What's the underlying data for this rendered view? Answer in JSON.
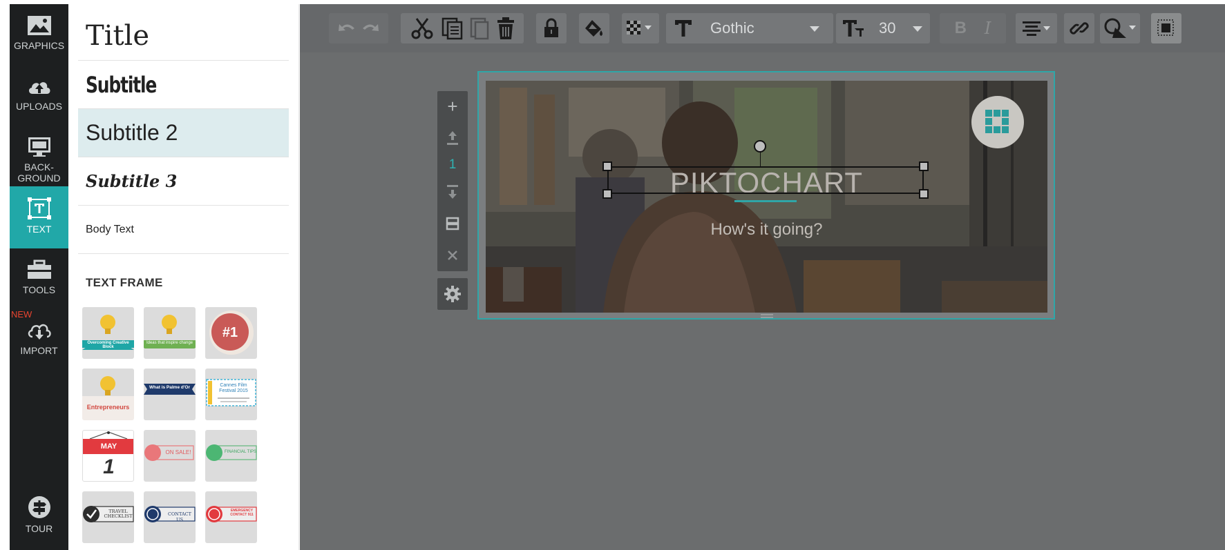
{
  "nav": {
    "items": [
      {
        "label": "GRAPHICS"
      },
      {
        "label": "UPLOADS"
      },
      {
        "label": "BACK-\nGROUND"
      },
      {
        "label": "TEXT"
      },
      {
        "label": "TOOLS"
      },
      {
        "label": "IMPORT",
        "badge": "NEW"
      }
    ],
    "tour": {
      "label": "TOUR"
    }
  },
  "panel": {
    "styles": [
      {
        "label": "Title"
      },
      {
        "label": "Subtitle"
      },
      {
        "label": "Subtitle 2"
      },
      {
        "label": "Subtitle 3"
      },
      {
        "label": "Body Text"
      }
    ],
    "frames_heading": "TEXT FRAME",
    "frames": [
      {
        "text": "Overcoming Creative Block"
      },
      {
        "text": "Ideas that inspire change"
      },
      {
        "text": "#1"
      },
      {
        "text": "Entrepreneurs"
      },
      {
        "text": "What is Palme d'Or"
      },
      {
        "text": "Cannes Film Festival 2015"
      },
      {
        "month": "MAY",
        "day": "1"
      },
      {
        "text": "ON SALE!"
      },
      {
        "text": "FINANCIAL TIPS"
      },
      {
        "text": "TRAVEL CHECKLIST"
      },
      {
        "text": "CONTACT US"
      },
      {
        "text": "EMERGENCY CONTACT 911"
      }
    ]
  },
  "toolbar": {
    "font_name": "Gothic",
    "font_size": "30",
    "bold_label": "B",
    "italic_label": "I"
  },
  "side_tools": {
    "page_number": "1"
  },
  "canvas": {
    "title": "PIKTOCHART",
    "subtitle": "How's it going?"
  },
  "colors": {
    "accent": "#21a8a8",
    "nav_bg": "#1d1f20",
    "new_badge": "#e8442f"
  }
}
